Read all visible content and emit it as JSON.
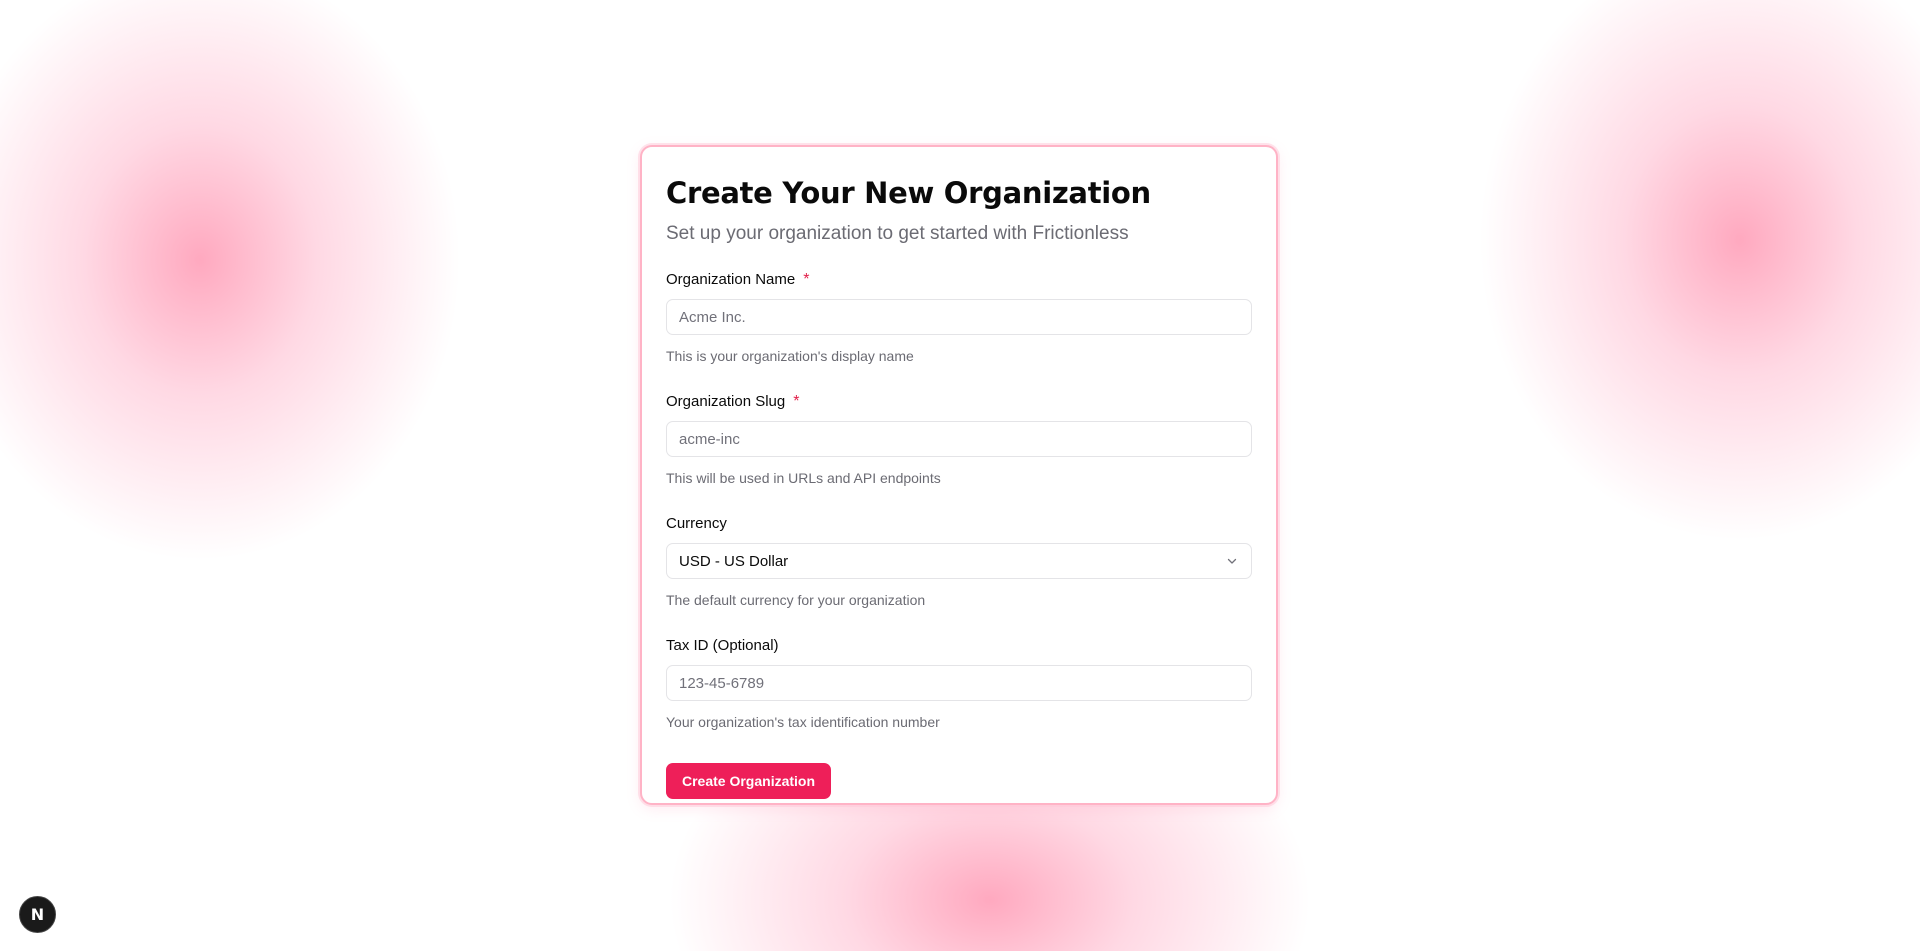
{
  "form": {
    "title": "Create Your New Organization",
    "subtitle": "Set up your organization to get started with Frictionless",
    "fields": {
      "org_name": {
        "label": "Organization Name",
        "required_marker": "*",
        "placeholder": "Acme Inc.",
        "value": "",
        "help": "This is your organization's display name"
      },
      "org_slug": {
        "label": "Organization Slug",
        "required_marker": "*",
        "placeholder": "acme-inc",
        "value": "",
        "help": "This will be used in URLs and API endpoints"
      },
      "currency": {
        "label": "Currency",
        "selected": "USD - US Dollar",
        "help": "The default currency for your organization"
      },
      "tax_id": {
        "label": "Tax ID (Optional)",
        "placeholder": "123-45-6789",
        "value": "",
        "help": "Your organization's tax identification number"
      }
    },
    "submit_label": "Create Organization"
  },
  "badge": {
    "letter": "N",
    "icon": "nextjs-logo-icon"
  },
  "colors": {
    "accent": "#ee1f59",
    "required": "#e11d48",
    "card_border": "#ffb3c6",
    "background_blob": "#ff8caa"
  }
}
